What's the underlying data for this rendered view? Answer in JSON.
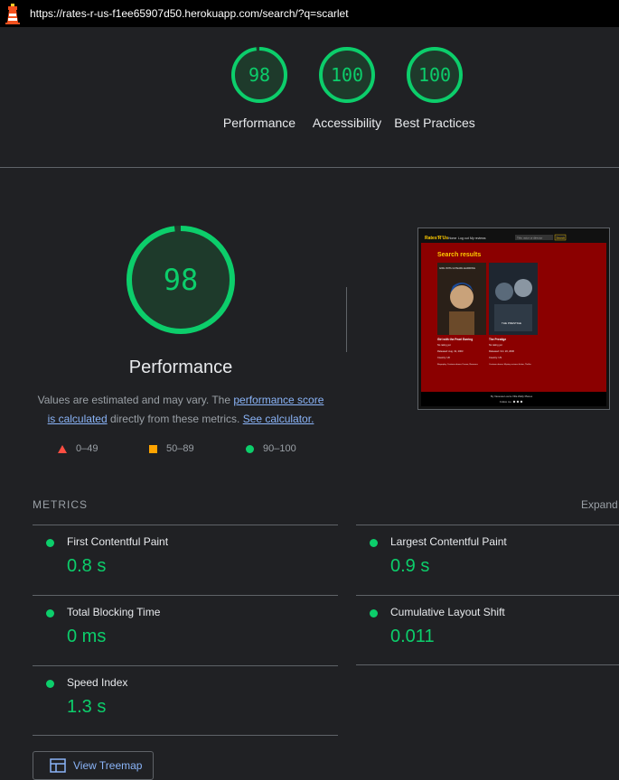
{
  "browser": {
    "url": "https://rates-r-us-f1ee65907d50.herokuapp.com/search/?q=scarlet"
  },
  "summary_gauges": [
    {
      "score": "98",
      "label": "Performance"
    },
    {
      "score": "100",
      "label": "Accessibility"
    },
    {
      "score": "100",
      "label": "Best Practices"
    }
  ],
  "performance": {
    "score": "98",
    "score_fraction": 0.98,
    "title": "Performance",
    "estimate_pre": "Values are estimated and may vary. The ",
    "estimate_link": "performance score is calculated",
    "estimate_mid": " directly from these metrics. ",
    "calculator_link": "See calculator.",
    "legend": [
      {
        "range": "0–49",
        "color": "#ff4e42",
        "shape": "triangle"
      },
      {
        "range": "50–89",
        "color": "#ffa400",
        "shape": "square"
      },
      {
        "range": "90–100",
        "color": "#0cce6b",
        "shape": "circle"
      }
    ]
  },
  "screenshot": {
    "site_name": "Rates'R'Us",
    "nav_items": [
      "Home",
      "Log out",
      "My reviews"
    ],
    "search_placeholder": "Title, actor or director",
    "search_button": "Search",
    "heading": "Search results",
    "cards": [
      {
        "poster_title": "GIRL WITH A PEARL EARRING",
        "title": "Girl with the Pearl Earring",
        "rating": "No rating yet",
        "released": "Released: Aug. 31, 2003",
        "country": "Country: UK",
        "genres": "Biography, Costume drama, Drama, Romance"
      },
      {
        "poster_title": "THE PRESTIGE",
        "title": "The Prestige",
        "rating": "No rating yet",
        "released": "Released: Oct. 20, 2006",
        "country": "Country: US",
        "genres": "Costume drama, Mystery science fiction, Thriller"
      }
    ],
    "footer_credit": "By Vanessa Lourie Villa Wally Planes",
    "footer_follow": "Follow me"
  },
  "metrics": {
    "title": "METRICS",
    "expand_label": "Expand view",
    "items": [
      {
        "name": "First Contentful Paint",
        "value": "0.8 s"
      },
      {
        "name": "Largest Contentful Paint",
        "value": "0.9 s"
      },
      {
        "name": "Total Blocking Time",
        "value": "0 ms"
      },
      {
        "name": "Cumulative Layout Shift",
        "value": "0.011"
      },
      {
        "name": "Speed Index",
        "value": "1.3 s"
      }
    ]
  },
  "treemap": {
    "label": "View Treemap"
  },
  "colors": {
    "pass": "#0cce6b",
    "average": "#ffa400",
    "fail": "#ff4e42",
    "link": "#8ab4f8",
    "background": "#202124"
  }
}
